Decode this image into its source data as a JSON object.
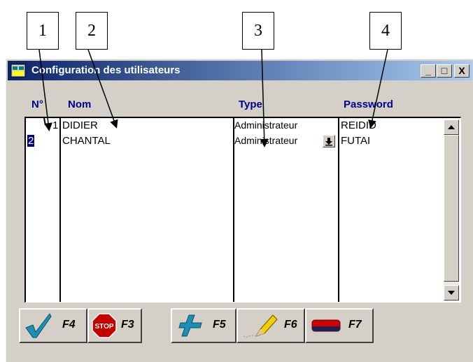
{
  "callouts": [
    "1",
    "2",
    "3",
    "4"
  ],
  "window": {
    "title": "Configuration des utilisateurs",
    "controls": {
      "minimize": "_",
      "maximize": "□",
      "close": "X"
    }
  },
  "grid": {
    "headers": {
      "num": "N°",
      "name": "Nom",
      "type": "Type",
      "password": "Password"
    },
    "rows": [
      {
        "num": "1",
        "name": "DIDIER",
        "type": "Administrateur",
        "password": "REIDID"
      },
      {
        "num": "2",
        "name": "CHANTAL",
        "type": "Administrateur",
        "password": "FUTAI"
      }
    ]
  },
  "toolbar": {
    "validate_key": "F4",
    "stop_key": "F3",
    "stop_sign_text": "STOP",
    "add_key": "F5",
    "edit_key": "F6",
    "delete_key": "F7"
  },
  "colors": {
    "titlebar_start": "#0a246a",
    "titlebar_end": "#a6caf0",
    "header_text": "#000090"
  }
}
